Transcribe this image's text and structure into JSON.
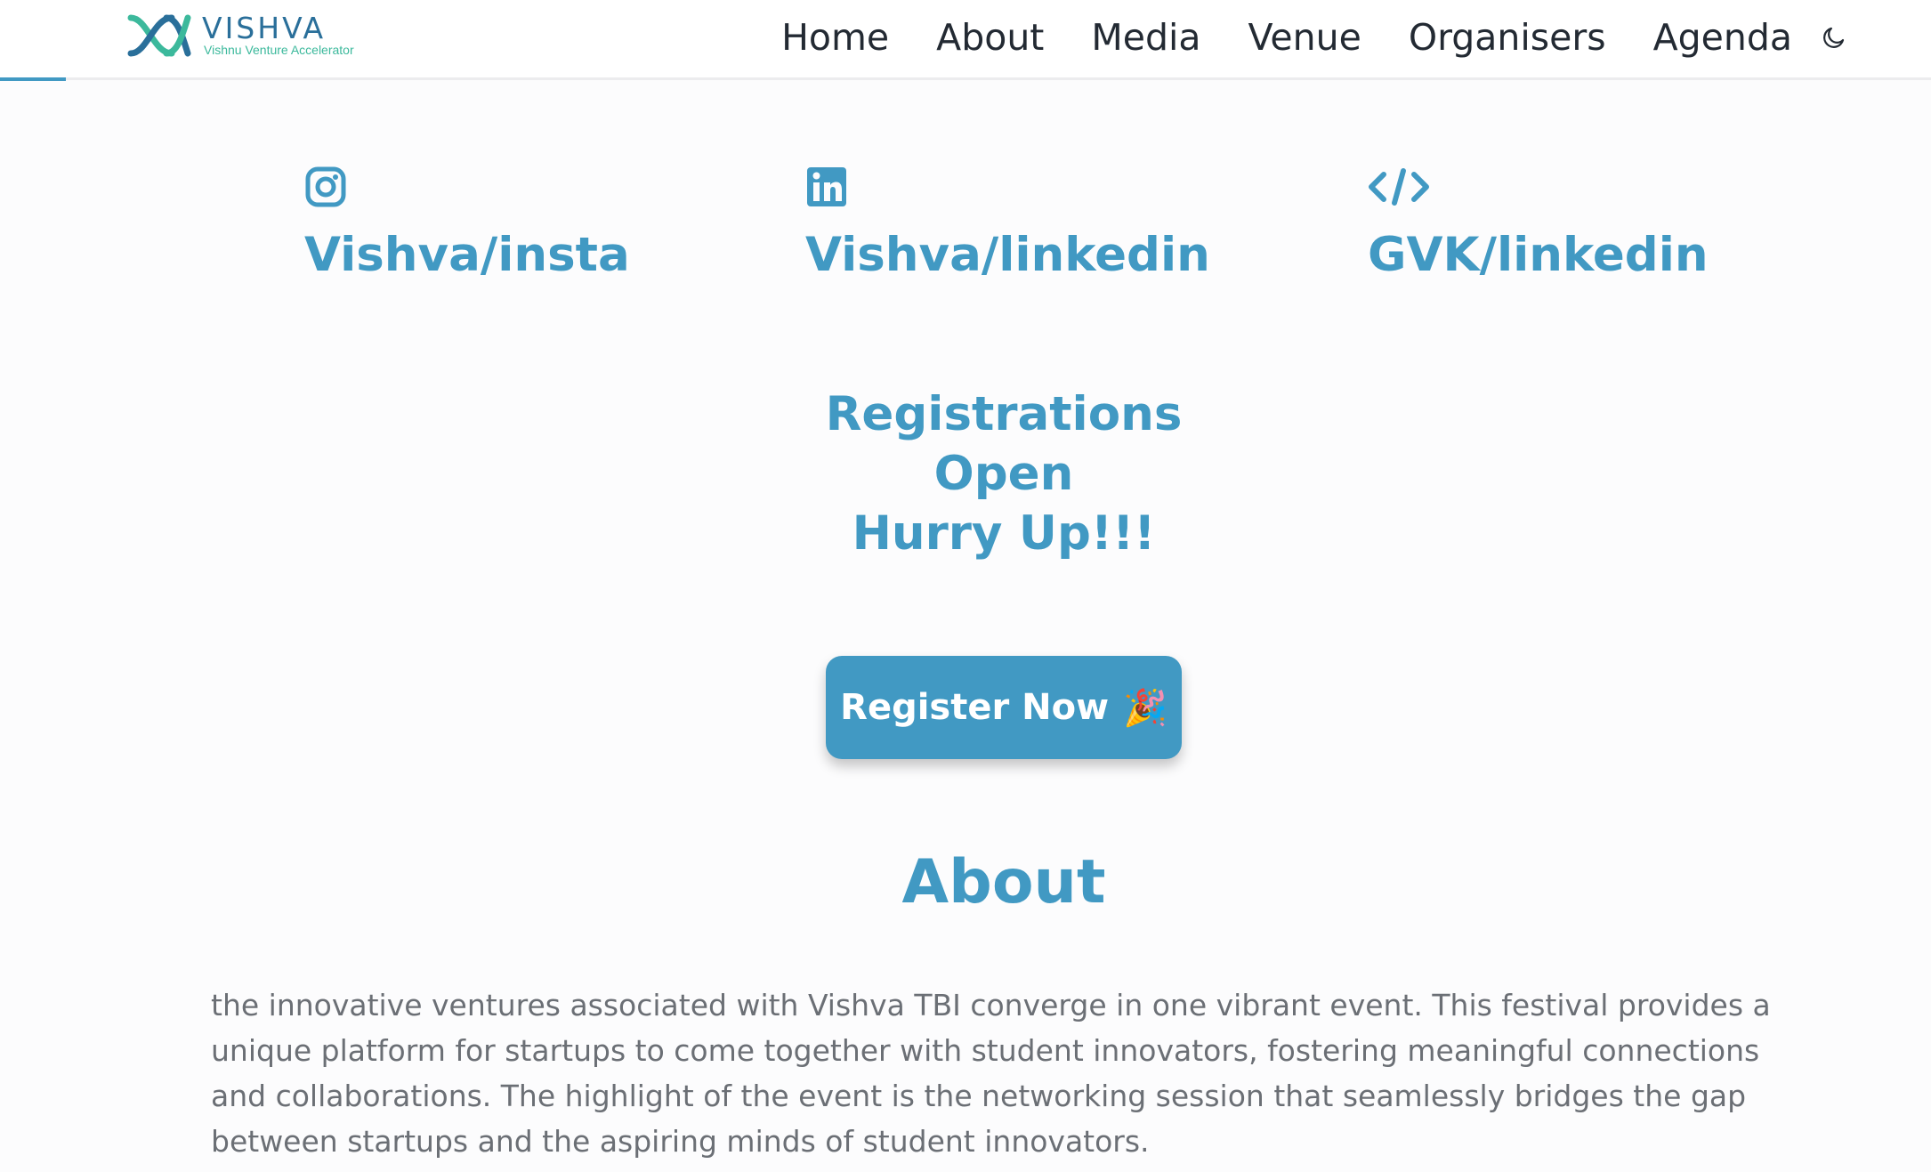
{
  "brand": {
    "name": "VISHVA",
    "tagline": "Vishnu Venture Accelerator",
    "colors": {
      "teal": "#2a6f9a",
      "green": "#3cb99c"
    }
  },
  "nav": {
    "items": [
      {
        "label": "Home"
      },
      {
        "label": "About"
      },
      {
        "label": "Media"
      },
      {
        "label": "Venue"
      },
      {
        "label": "Organisers"
      },
      {
        "label": "Agenda"
      }
    ],
    "theme_toggle_icon": "moon-icon"
  },
  "social_links": [
    {
      "label": "Vishva/insta",
      "icon": "instagram-icon"
    },
    {
      "label": "Vishva/linkedin",
      "icon": "linkedin-icon"
    },
    {
      "label": "GVK/linkedin",
      "icon": "code-icon"
    }
  ],
  "registration": {
    "line1": "Registrations",
    "line2": "Open",
    "line3": "Hurry Up!!!",
    "button_label": "Register Now",
    "button_emoji": "🎉"
  },
  "about": {
    "title": "About",
    "text": "the innovative ventures associated with Vishva TBI converge in one vibrant event. This festival provides a unique platform for startups to come together with student innovators, fostering meaningful connections and collaborations. The highlight of the event is the networking session that seamlessly bridges the gap between startups and the aspiring minds of student innovators."
  },
  "colors": {
    "accent": "#4199c3",
    "nav_text": "#232a33",
    "body_text": "#6b6f75",
    "background": "#fcfcfd"
  }
}
